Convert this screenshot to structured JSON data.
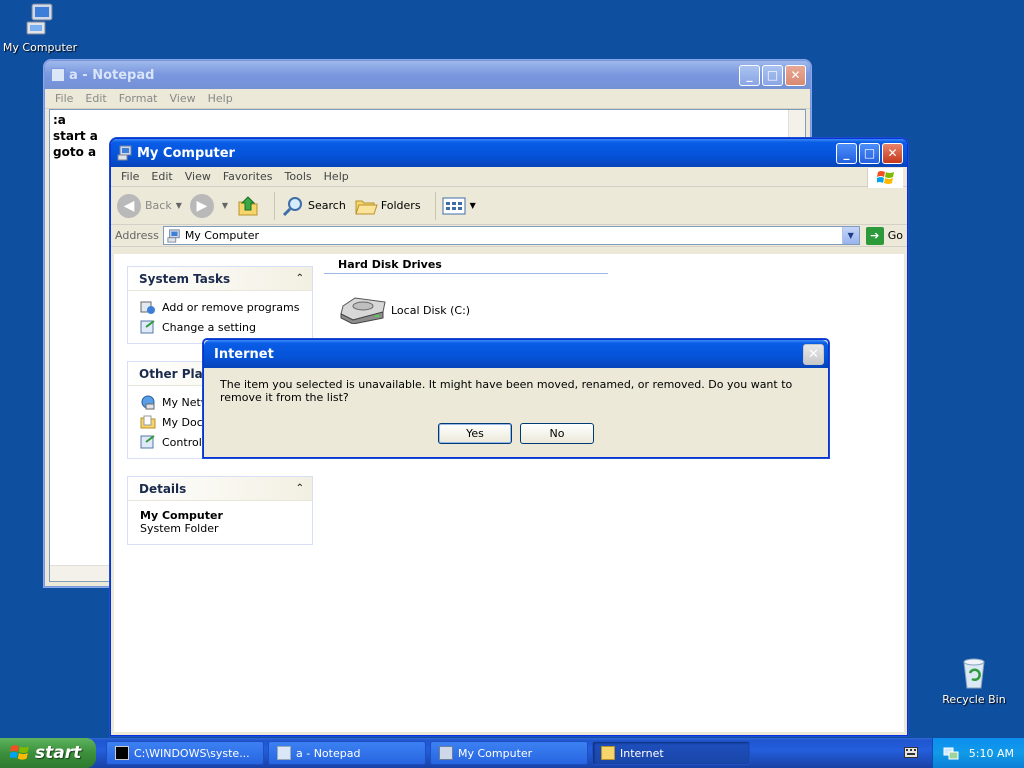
{
  "desktop": {
    "icons": [
      {
        "label": "My Computer"
      },
      {
        "label": "Recycle Bin"
      }
    ]
  },
  "notepad": {
    "title": "a - Notepad",
    "menu": [
      "File",
      "Edit",
      "Format",
      "View",
      "Help"
    ],
    "text": ":a\nstart a\ngoto a"
  },
  "mycomputer": {
    "title": "My Computer",
    "menu": [
      "File",
      "Edit",
      "View",
      "Favorites",
      "Tools",
      "Help"
    ],
    "toolbar": {
      "back": "Back",
      "search": "Search",
      "folders": "Folders"
    },
    "address": {
      "label": "Address",
      "value": "My Computer",
      "go": "Go"
    },
    "system_tasks": {
      "title": "System Tasks",
      "items": [
        "Add or remove programs",
        "Change a setting"
      ]
    },
    "other_places": {
      "title": "Other Places",
      "items": [
        "My Network Places",
        "My Documents",
        "Control Panel"
      ]
    },
    "details": {
      "title": "Details",
      "name": "My Computer",
      "type": "System Folder"
    },
    "groups": [
      {
        "title": "Hard Disk Drives",
        "items": [
          "Local Disk (C:)"
        ]
      }
    ]
  },
  "dialog": {
    "title": "Internet",
    "message": "The item you selected is unavailable.  It might have been moved, renamed, or removed.  Do you want to remove it from the list?",
    "yes": "Yes",
    "no": "No"
  },
  "taskbar": {
    "start": "start",
    "tasks": [
      {
        "label": "C:\\WINDOWS\\syste..."
      },
      {
        "label": "a - Notepad"
      },
      {
        "label": "My Computer"
      },
      {
        "label": "Internet"
      }
    ],
    "clock": "5:10 AM"
  }
}
